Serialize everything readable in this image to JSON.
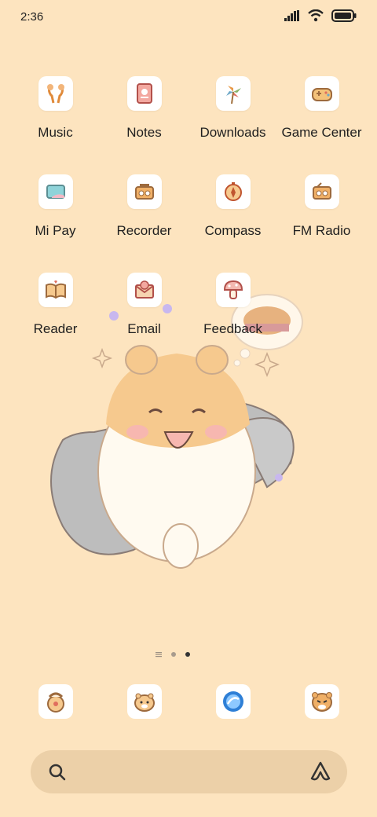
{
  "status": {
    "time": "2:36"
  },
  "apps": [
    {
      "label": "Music",
      "icon": "earphones-icon"
    },
    {
      "label": "Notes",
      "icon": "notebook-icon"
    },
    {
      "label": "Downloads",
      "icon": "pinwheel-icon"
    },
    {
      "label": "Game Center",
      "icon": "gamepad-icon"
    },
    {
      "label": "Mi Pay",
      "icon": "wallet-card-icon"
    },
    {
      "label": "Recorder",
      "icon": "radio-recorder-icon"
    },
    {
      "label": "Compass",
      "icon": "compass-icon"
    },
    {
      "label": "FM Radio",
      "icon": "radio-icon"
    },
    {
      "label": "Reader",
      "icon": "open-book-icon"
    },
    {
      "label": "Email",
      "icon": "envelope-icon"
    },
    {
      "label": "Feedback",
      "icon": "mushroom-icon"
    }
  ],
  "dock": [
    "phone-icon",
    "hamster-messages-icon",
    "browser-globe-icon",
    "hamster-camera-icon"
  ],
  "page_indicator": {
    "current": 3,
    "total": 3
  },
  "colors": {
    "background": "#fde4bf",
    "search_bar": "#ecd0a8"
  }
}
